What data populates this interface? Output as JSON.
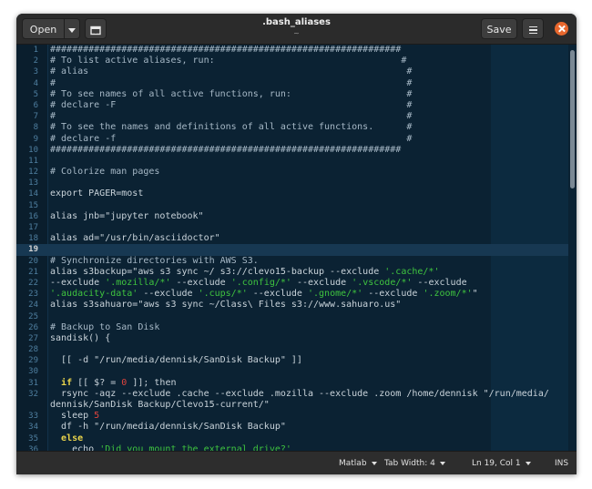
{
  "header": {
    "open_label": "Open",
    "title": ".bash_aliases",
    "subtitle": "~",
    "save_label": "Save"
  },
  "icons": {
    "open_menu": "chevron-down-icon",
    "new_tab": "new-tab-icon",
    "menu": "hamburger-menu-icon",
    "close": "close-icon"
  },
  "colors": {
    "editor_bg": "#0b2233",
    "close_button": "#e8672d",
    "string_green": "#3fc43f",
    "number_red": "#e0443e",
    "keyword_yellow": "#e8d34b"
  },
  "editor": {
    "current_line": 19,
    "lines": [
      {
        "n": "1",
        "segs": [
          {
            "t": "################################################################",
            "c": "comment"
          }
        ]
      },
      {
        "n": "2",
        "segs": [
          {
            "t": "# To list active aliases, run:                                  #",
            "c": "comment"
          }
        ]
      },
      {
        "n": "3",
        "segs": [
          {
            "t": "# alias                                                          #",
            "c": "comment"
          }
        ]
      },
      {
        "n": "4",
        "segs": [
          {
            "t": "#                                                                #",
            "c": "comment"
          }
        ]
      },
      {
        "n": "5",
        "segs": [
          {
            "t": "# To see names of all active functions, run:                     #",
            "c": "comment"
          }
        ]
      },
      {
        "n": "6",
        "segs": [
          {
            "t": "# declare -F                                                     #",
            "c": "comment"
          }
        ]
      },
      {
        "n": "7",
        "segs": [
          {
            "t": "#                                                                #",
            "c": "comment"
          }
        ]
      },
      {
        "n": "8",
        "segs": [
          {
            "t": "# To see the names and definitions of all active functions.      #",
            "c": "comment"
          }
        ]
      },
      {
        "n": "9",
        "segs": [
          {
            "t": "# declare -f                                                     #",
            "c": "comment"
          }
        ]
      },
      {
        "n": "10",
        "segs": [
          {
            "t": "################################################################",
            "c": "comment"
          }
        ]
      },
      {
        "n": "11",
        "segs": []
      },
      {
        "n": "12",
        "segs": [
          {
            "t": "# Colorize man pages",
            "c": "comment"
          }
        ]
      },
      {
        "n": "13",
        "segs": []
      },
      {
        "n": "14",
        "segs": [
          {
            "t": "export PAGER=most",
            "c": ""
          }
        ]
      },
      {
        "n": "15",
        "segs": []
      },
      {
        "n": "16",
        "segs": [
          {
            "t": "alias jnb=\"jupyter notebook\"",
            "c": ""
          }
        ]
      },
      {
        "n": "17",
        "segs": []
      },
      {
        "n": "18",
        "segs": [
          {
            "t": "alias ad=\"/usr/bin/asciidoctor\"",
            "c": ""
          }
        ]
      },
      {
        "n": "19",
        "segs": []
      },
      {
        "n": "20",
        "segs": [
          {
            "t": "# Synchronize directories with AWS S3.",
            "c": "comment"
          }
        ]
      },
      {
        "n": "21",
        "segs": [
          {
            "t": "alias s3backup=\"aws s3 sync ~/ s3://clevo15-backup --exclude ",
            "c": ""
          },
          {
            "t": "'.cache/*'",
            "c": "green"
          }
        ]
      },
      {
        "n": "22",
        "segs": [
          {
            "t": "--exclude ",
            "c": ""
          },
          {
            "t": "'.mozilla/*'",
            "c": "green"
          },
          {
            "t": " --exclude ",
            "c": ""
          },
          {
            "t": "'.config/*'",
            "c": "green"
          },
          {
            "t": " --exclude ",
            "c": ""
          },
          {
            "t": "'.vscode/*'",
            "c": "green"
          },
          {
            "t": " --exclude",
            "c": ""
          }
        ]
      },
      {
        "n": "23",
        "segs": [
          {
            "t": "'.audacity-data'",
            "c": "green"
          },
          {
            "t": " --exclude ",
            "c": ""
          },
          {
            "t": "'.cups/*'",
            "c": "green"
          },
          {
            "t": " --exclude ",
            "c": ""
          },
          {
            "t": "'.gnome/*'",
            "c": "green"
          },
          {
            "t": " --exclude ",
            "c": ""
          },
          {
            "t": "'.zoom/*'",
            "c": "green"
          },
          {
            "t": "\"",
            "c": ""
          }
        ]
      },
      {
        "n": "24",
        "segs": [
          {
            "t": "alias s3sahuaro=\"aws s3 sync ~/Class\\ Files s3://www.sahuaro.us\"",
            "c": ""
          }
        ]
      },
      {
        "n": "25",
        "segs": []
      },
      {
        "n": "26",
        "segs": [
          {
            "t": "# Backup to San Disk",
            "c": "comment"
          }
        ]
      },
      {
        "n": "27",
        "segs": [
          {
            "t": "sandisk() {",
            "c": ""
          }
        ]
      },
      {
        "n": "28",
        "segs": []
      },
      {
        "n": "29",
        "segs": [
          {
            "t": "  [[ -d \"/run/media/dennisk/SanDisk Backup\" ]]",
            "c": ""
          }
        ]
      },
      {
        "n": "30",
        "segs": []
      },
      {
        "n": "31",
        "segs": [
          {
            "t": "  ",
            "c": ""
          },
          {
            "t": "if",
            "c": "kw"
          },
          {
            "t": " [[ $? = ",
            "c": ""
          },
          {
            "t": "0",
            "c": "red"
          },
          {
            "t": " ]]; then",
            "c": ""
          }
        ]
      },
      {
        "n": "32",
        "segs": [
          {
            "t": "  rsync -aqz --exclude .cache --exclude .mozilla --exclude .zoom /home/dennisk \"/run/media/",
            "c": ""
          }
        ]
      },
      {
        "n": "",
        "segs": [
          {
            "t": "dennisk/SanDisk Backup/Clevo15-current/\"",
            "c": ""
          }
        ]
      },
      {
        "n": "33",
        "segs": [
          {
            "t": "  sleep ",
            "c": ""
          },
          {
            "t": "5",
            "c": "red"
          }
        ]
      },
      {
        "n": "34",
        "segs": [
          {
            "t": "  df -h \"/run/media/dennisk/SanDisk Backup\"",
            "c": ""
          }
        ]
      },
      {
        "n": "35",
        "segs": [
          {
            "t": "  ",
            "c": ""
          },
          {
            "t": "else",
            "c": "kw"
          }
        ]
      },
      {
        "n": "36",
        "segs": [
          {
            "t": "    echo ",
            "c": ""
          },
          {
            "t": "'Did you mount the external drive?'",
            "c": "green"
          }
        ]
      },
      {
        "n": "37",
        "segs": [
          {
            "t": "  fi",
            "c": ""
          }
        ]
      }
    ]
  },
  "statusbar": {
    "language": "Matlab",
    "tab_width": "Tab Width: 4",
    "position": "Ln 19, Col 1",
    "mode": "INS"
  }
}
